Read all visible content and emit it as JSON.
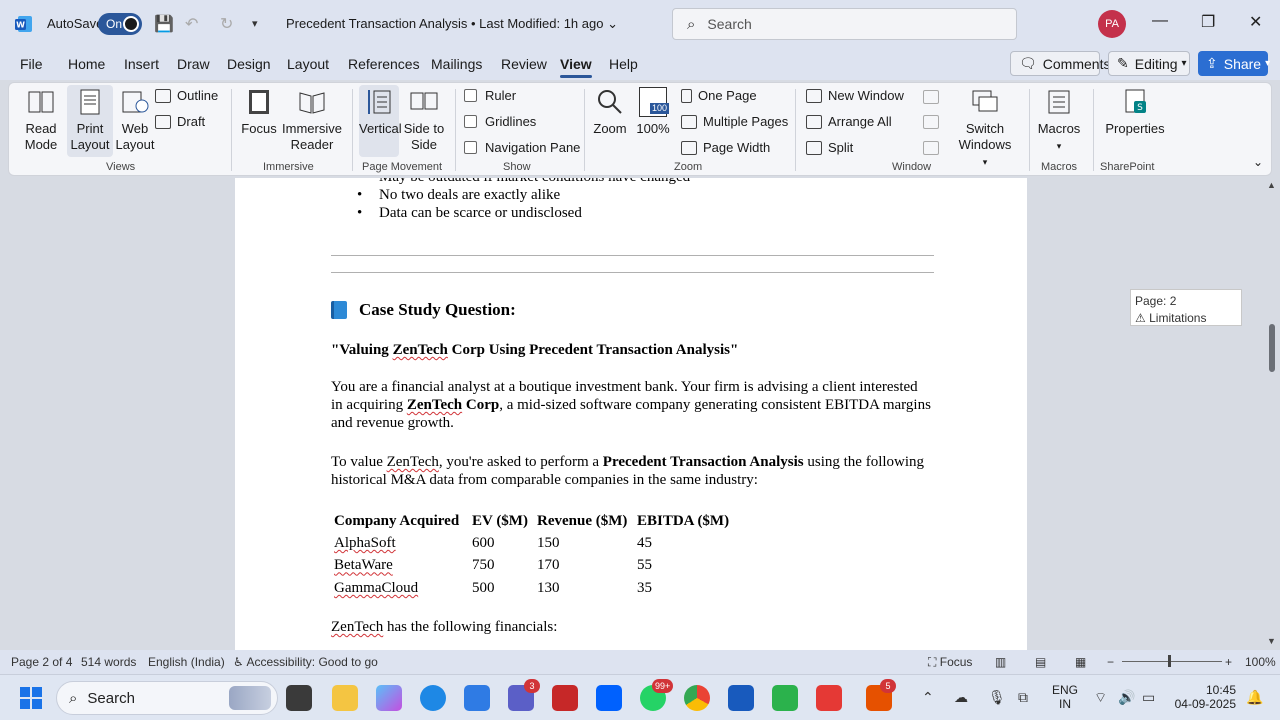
{
  "titlebar": {
    "autosave_label": "AutoSave",
    "autosave_state": "On",
    "document_title": "Precedent Transaction Analysis • Last Modified: 1h ago",
    "search_placeholder": "Search",
    "user_initials": "PA"
  },
  "menu": {
    "tabs": [
      "File",
      "Home",
      "Insert",
      "Draw",
      "Design",
      "Layout",
      "References",
      "Mailings",
      "Review",
      "View",
      "Help"
    ],
    "active_tab": "View",
    "comments_label": "Comments",
    "editing_label": "Editing",
    "share_label": "Share"
  },
  "ribbon": {
    "views": {
      "label": "Views",
      "read_mode": "Read Mode",
      "print_layout": "Print Layout",
      "web_layout": "Web Layout",
      "outline": "Outline",
      "draft": "Draft"
    },
    "immersive": {
      "label": "Immersive",
      "focus": "Focus",
      "immersive_reader": "Immersive Reader"
    },
    "page_movement": {
      "label": "Page Movement",
      "vertical": "Vertical",
      "side_to_side": "Side to Side"
    },
    "show": {
      "label": "Show",
      "ruler": "Ruler",
      "gridlines": "Gridlines",
      "navigation_pane": "Navigation Pane"
    },
    "zoom": {
      "label": "Zoom",
      "zoom": "Zoom",
      "hundred": "100%",
      "one_page": "One Page",
      "multiple_pages": "Multiple Pages",
      "page_width": "Page Width",
      "icon_text": "100"
    },
    "window": {
      "label": "Window",
      "new_window": "New Window",
      "arrange_all": "Arrange All",
      "split": "Split",
      "switch_windows": "Switch Windows"
    },
    "macros": {
      "label": "Macros",
      "macros": "Macros"
    },
    "sharepoint": {
      "label": "SharePoint",
      "properties": "Properties"
    }
  },
  "document": {
    "bullets": [
      "May be outdated if market conditions have changed",
      "No two deals are exactly alike",
      "Data can be scarce or undisclosed"
    ],
    "case_heading": "Case Study Question:",
    "case_title_pre": "\"Valuing ",
    "case_title_name": "ZenTech",
    "case_title_post": " Corp Using Precedent Transaction Analysis\"",
    "p1_a": "You are a financial analyst at a boutique investment bank. Your firm is advising a client interested in acquiring ",
    "p1_name": "ZenTech",
    "p1_b": " Corp",
    "p1_c": ", a mid-sized software company generating consistent EBITDA margins and revenue growth.",
    "p2_a": "To value ",
    "p2_name": "ZenTech",
    "p2_b": ", you're asked to perform a ",
    "p2_bold": "Precedent Transaction Analysis",
    "p2_c": " using the following historical M&A data from comparable companies in the same industry:",
    "table": {
      "headers": [
        "Company Acquired",
        "EV ($M)",
        "Revenue ($M)",
        "EBITDA ($M)"
      ],
      "rows": [
        [
          "AlphaSoft",
          "600",
          "150",
          "45"
        ],
        [
          "BetaWare",
          "750",
          "170",
          "55"
        ],
        [
          "GammaCloud",
          "500",
          "130",
          "35"
        ]
      ]
    },
    "p3_name": "ZenTech",
    "p3_rest": " has the following financials:"
  },
  "tooltip": {
    "page": "Page: 2",
    "section": "Limitations"
  },
  "statusbar": {
    "page": "Page 2 of 4",
    "words": "514 words",
    "language": "English (India)",
    "accessibility": "Accessibility: Good to go",
    "focus": "Focus",
    "zoom": "100%"
  },
  "taskbar": {
    "search": "Search",
    "badge_teams": "3",
    "badge_whatsapp": "99+",
    "badge_app": "5",
    "lang_top": "ENG",
    "lang_bottom": "IN",
    "time": "10:45",
    "date": "04-09-2025"
  },
  "colors": {
    "accent": "#2b579a",
    "share": "#2b6ed2",
    "avatar": "#c4314b"
  }
}
